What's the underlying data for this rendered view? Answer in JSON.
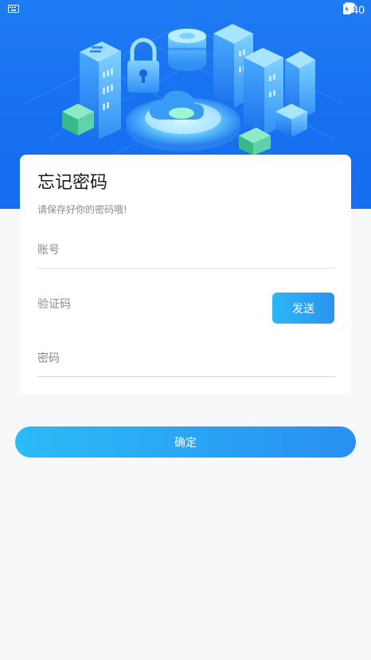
{
  "status_bar": {
    "time": "4:40",
    "icons": [
      "keyboard-icon",
      "wifi-icon",
      "signal-icon",
      "battery-icon"
    ]
  },
  "form": {
    "title": "忘记密码",
    "subtitle": "请保存好你的密码哦!",
    "account_placeholder": "账号",
    "code_placeholder": "验证码",
    "password_placeholder": "密码",
    "send_label": "发送"
  },
  "confirm_label": "确定",
  "colors": {
    "hero_blue": "#1670f0",
    "accent_light": "#2db7f5",
    "accent_dark": "#2a8ff1",
    "background": "#f7f8fa"
  }
}
